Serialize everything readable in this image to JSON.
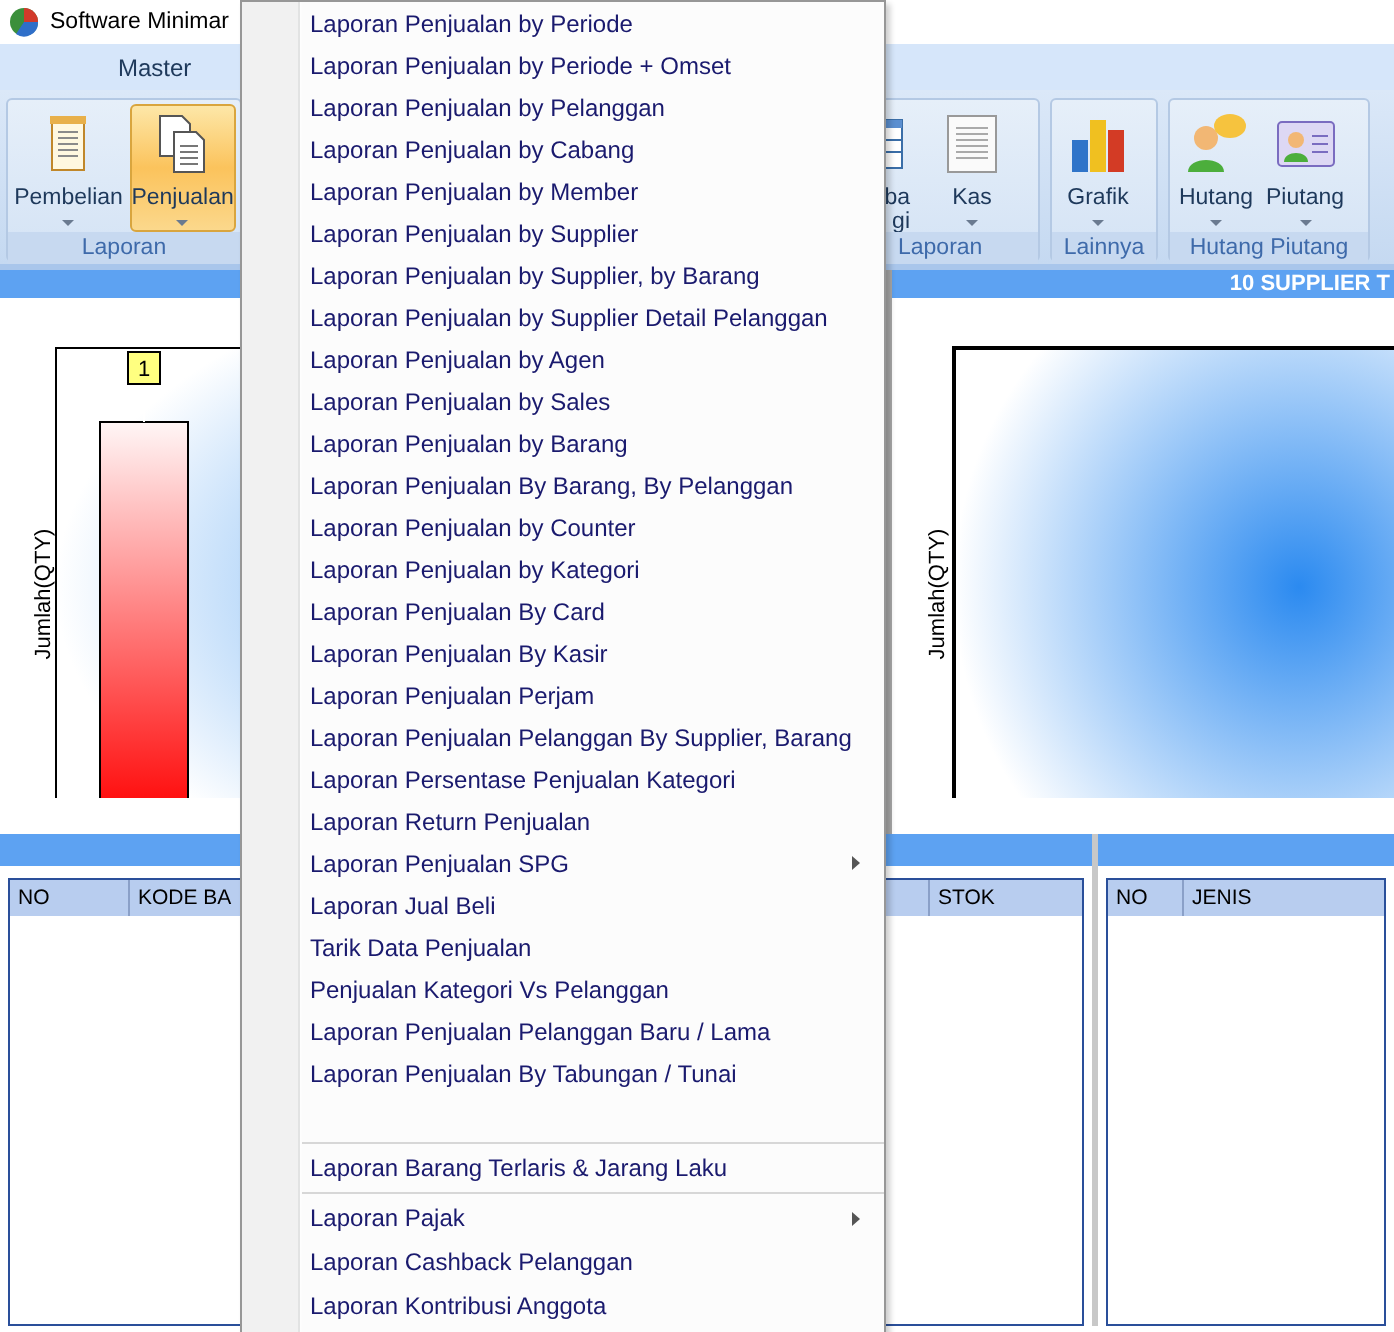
{
  "window": {
    "title": "Software Minimar"
  },
  "ribbon": {
    "tabs": [
      {
        "label": "Master"
      }
    ],
    "groups": [
      {
        "label": "Laporan",
        "buttons": [
          {
            "label": "Pembelian",
            "kind": "document",
            "selected": false,
            "dropdown": true
          },
          {
            "label": "Penjualan",
            "kind": "documents",
            "selected": true,
            "dropdown": true
          }
        ]
      },
      {
        "label": "Laporan",
        "buttons": [
          {
            "label": "ba\ngi",
            "kind": "grid",
            "selected": false,
            "dropdown": false
          },
          {
            "label": "Kas",
            "kind": "sheet",
            "selected": false,
            "dropdown": true
          }
        ]
      },
      {
        "label": "Lainnya",
        "buttons": [
          {
            "label": "Grafik",
            "kind": "chart",
            "selected": false,
            "dropdown": true
          }
        ]
      },
      {
        "label": "Hutang Piutang",
        "buttons": [
          {
            "label": "Hutang",
            "kind": "person-chat",
            "selected": false,
            "dropdown": true
          },
          {
            "label": "Piutang",
            "kind": "person-card",
            "selected": false,
            "dropdown": true
          }
        ]
      }
    ]
  },
  "charts": [
    {
      "ylabel": "Jumlah(QTY)",
      "bar_labels": [
        "1"
      ]
    },
    {
      "title": "10 SUPPLIER T",
      "ylabel": "Jumlah(QTY)"
    }
  ],
  "tables": [
    {
      "columns": [
        "NO",
        "KODE BA",
        "STOK"
      ]
    },
    {
      "columns": [
        "NO",
        "JENIS"
      ]
    }
  ],
  "menu": {
    "groups": [
      [
        {
          "label": "Laporan Penjualan by Periode",
          "has_submenu": false
        },
        {
          "label": "Laporan Penjualan by Periode + Omset",
          "has_submenu": false
        },
        {
          "label": "Laporan Penjualan by Pelanggan",
          "has_submenu": false
        },
        {
          "label": "Laporan Penjualan by Cabang",
          "has_submenu": false
        },
        {
          "label": "Laporan Penjualan by Member",
          "has_submenu": false
        },
        {
          "label": "Laporan Penjualan by Supplier",
          "has_submenu": false
        },
        {
          "label": "Laporan Penjualan by Supplier, by Barang",
          "has_submenu": false
        },
        {
          "label": "Laporan Penjualan by Supplier Detail Pelanggan",
          "has_submenu": false
        },
        {
          "label": "Laporan Penjualan by Agen",
          "has_submenu": false
        },
        {
          "label": "Laporan Penjualan by Sales",
          "has_submenu": false
        },
        {
          "label": "Laporan Penjualan by Barang",
          "has_submenu": false
        },
        {
          "label": "Laporan Penjualan By Barang, By Pelanggan",
          "has_submenu": false
        },
        {
          "label": "Laporan Penjualan by Counter",
          "has_submenu": false
        },
        {
          "label": "Laporan Penjualan by Kategori",
          "has_submenu": false
        },
        {
          "label": "Laporan Penjualan By Card",
          "has_submenu": false
        },
        {
          "label": "Laporan Penjualan By Kasir",
          "has_submenu": false
        },
        {
          "label": "Laporan Penjualan Perjam",
          "has_submenu": false
        },
        {
          "label": "Laporan Penjualan Pelanggan By Supplier, Barang",
          "has_submenu": false
        },
        {
          "label": "Laporan Persentase Penjualan Kategori",
          "has_submenu": false
        },
        {
          "label": "Laporan Return Penjualan",
          "has_submenu": false
        },
        {
          "label": "Laporan Penjualan SPG",
          "has_submenu": true
        },
        {
          "label": "Laporan Jual Beli",
          "has_submenu": false
        },
        {
          "label": "Tarik Data Penjualan",
          "has_submenu": false
        },
        {
          "label": "Penjualan Kategori Vs Pelanggan",
          "has_submenu": false
        },
        {
          "label": "Laporan Penjualan Pelanggan Baru / Lama",
          "has_submenu": false
        },
        {
          "label": "Laporan Penjualan By Tabungan / Tunai",
          "has_submenu": false
        }
      ],
      [
        {
          "label": "Laporan Barang Terlaris & Jarang Laku",
          "has_submenu": false
        }
      ],
      [
        {
          "label": "Laporan Pajak",
          "has_submenu": true
        },
        {
          "label": "Laporan Cashback Pelanggan",
          "has_submenu": false
        },
        {
          "label": "Laporan Kontribusi Anggota",
          "has_submenu": false
        }
      ]
    ]
  }
}
